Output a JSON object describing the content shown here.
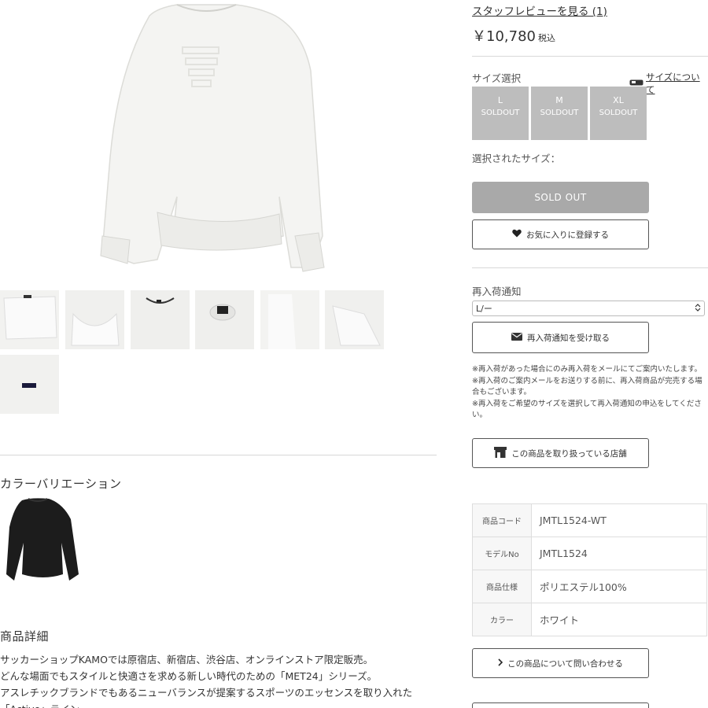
{
  "product": {
    "review_link": "スタッフレビューを見る (1)",
    "price": "￥10,780",
    "tax_label": "税込"
  },
  "size": {
    "label": "サイズ選択",
    "guide_link": "サイズについて",
    "options": [
      {
        "name": "L",
        "status": "SOLDOUT"
      },
      {
        "name": "M",
        "status": "SOLDOUT"
      },
      {
        "name": "XL",
        "status": "SOLDOUT"
      }
    ],
    "selected_label": "選択されたサイズ："
  },
  "actions": {
    "soldout": "SOLD OUT",
    "favorite": "お気に入りに登録する",
    "restock_label": "再入荷通知",
    "restock_select": "L/ー",
    "restock_button": "再入荷通知を受け取る",
    "stores_button": "この商品を取り扱っている店舗",
    "contact_button": "この商品について問い合わせる"
  },
  "notes": [
    "※再入荷があった場合にのみ再入荷をメールにてご案内いたします。",
    "※再入荷のご案内メールをお送りする前に、再入荷商品が完売する場合もございます。",
    "※再入荷をご希望のサイズを選択して再入荷通知の申込をしてください。"
  ],
  "specs": [
    {
      "key": "商品コード",
      "value": "JMTL1524-WT"
    },
    {
      "key": "モデルNo",
      "value": "JMTL1524"
    },
    {
      "key": "商品仕様",
      "value": "ポリエステル100%"
    },
    {
      "key": "カラー",
      "value": "ホワイト"
    }
  ],
  "variation": {
    "title": "カラーバリエーション"
  },
  "details": {
    "title": "商品詳細",
    "lines": [
      "サッカーショップKAMOでは原宿店、新宿店、渋谷店、オンラインストア限定販売。",
      "どんな場面でもスタイルと快適さを求める新しい時代のための「MET24」シリーズ。",
      "アスレチックブランドでもあるニューバランスが提案するスポーツのエッセンスを取り入れた",
      "「Active」ライン"
    ]
  },
  "colors": {
    "soldout_gray": "#bdbdbd",
    "soldout_button": "#a9a9a9",
    "garment_white": "#f4f4f2",
    "garment_black": "#1c1c1c"
  },
  "icons": {
    "heart": "heart-icon",
    "mail": "mail-icon",
    "store": "store-icon",
    "chevron": "chevron-right-icon",
    "ruler": "ruler-icon",
    "select": "select-arrows-icon"
  }
}
